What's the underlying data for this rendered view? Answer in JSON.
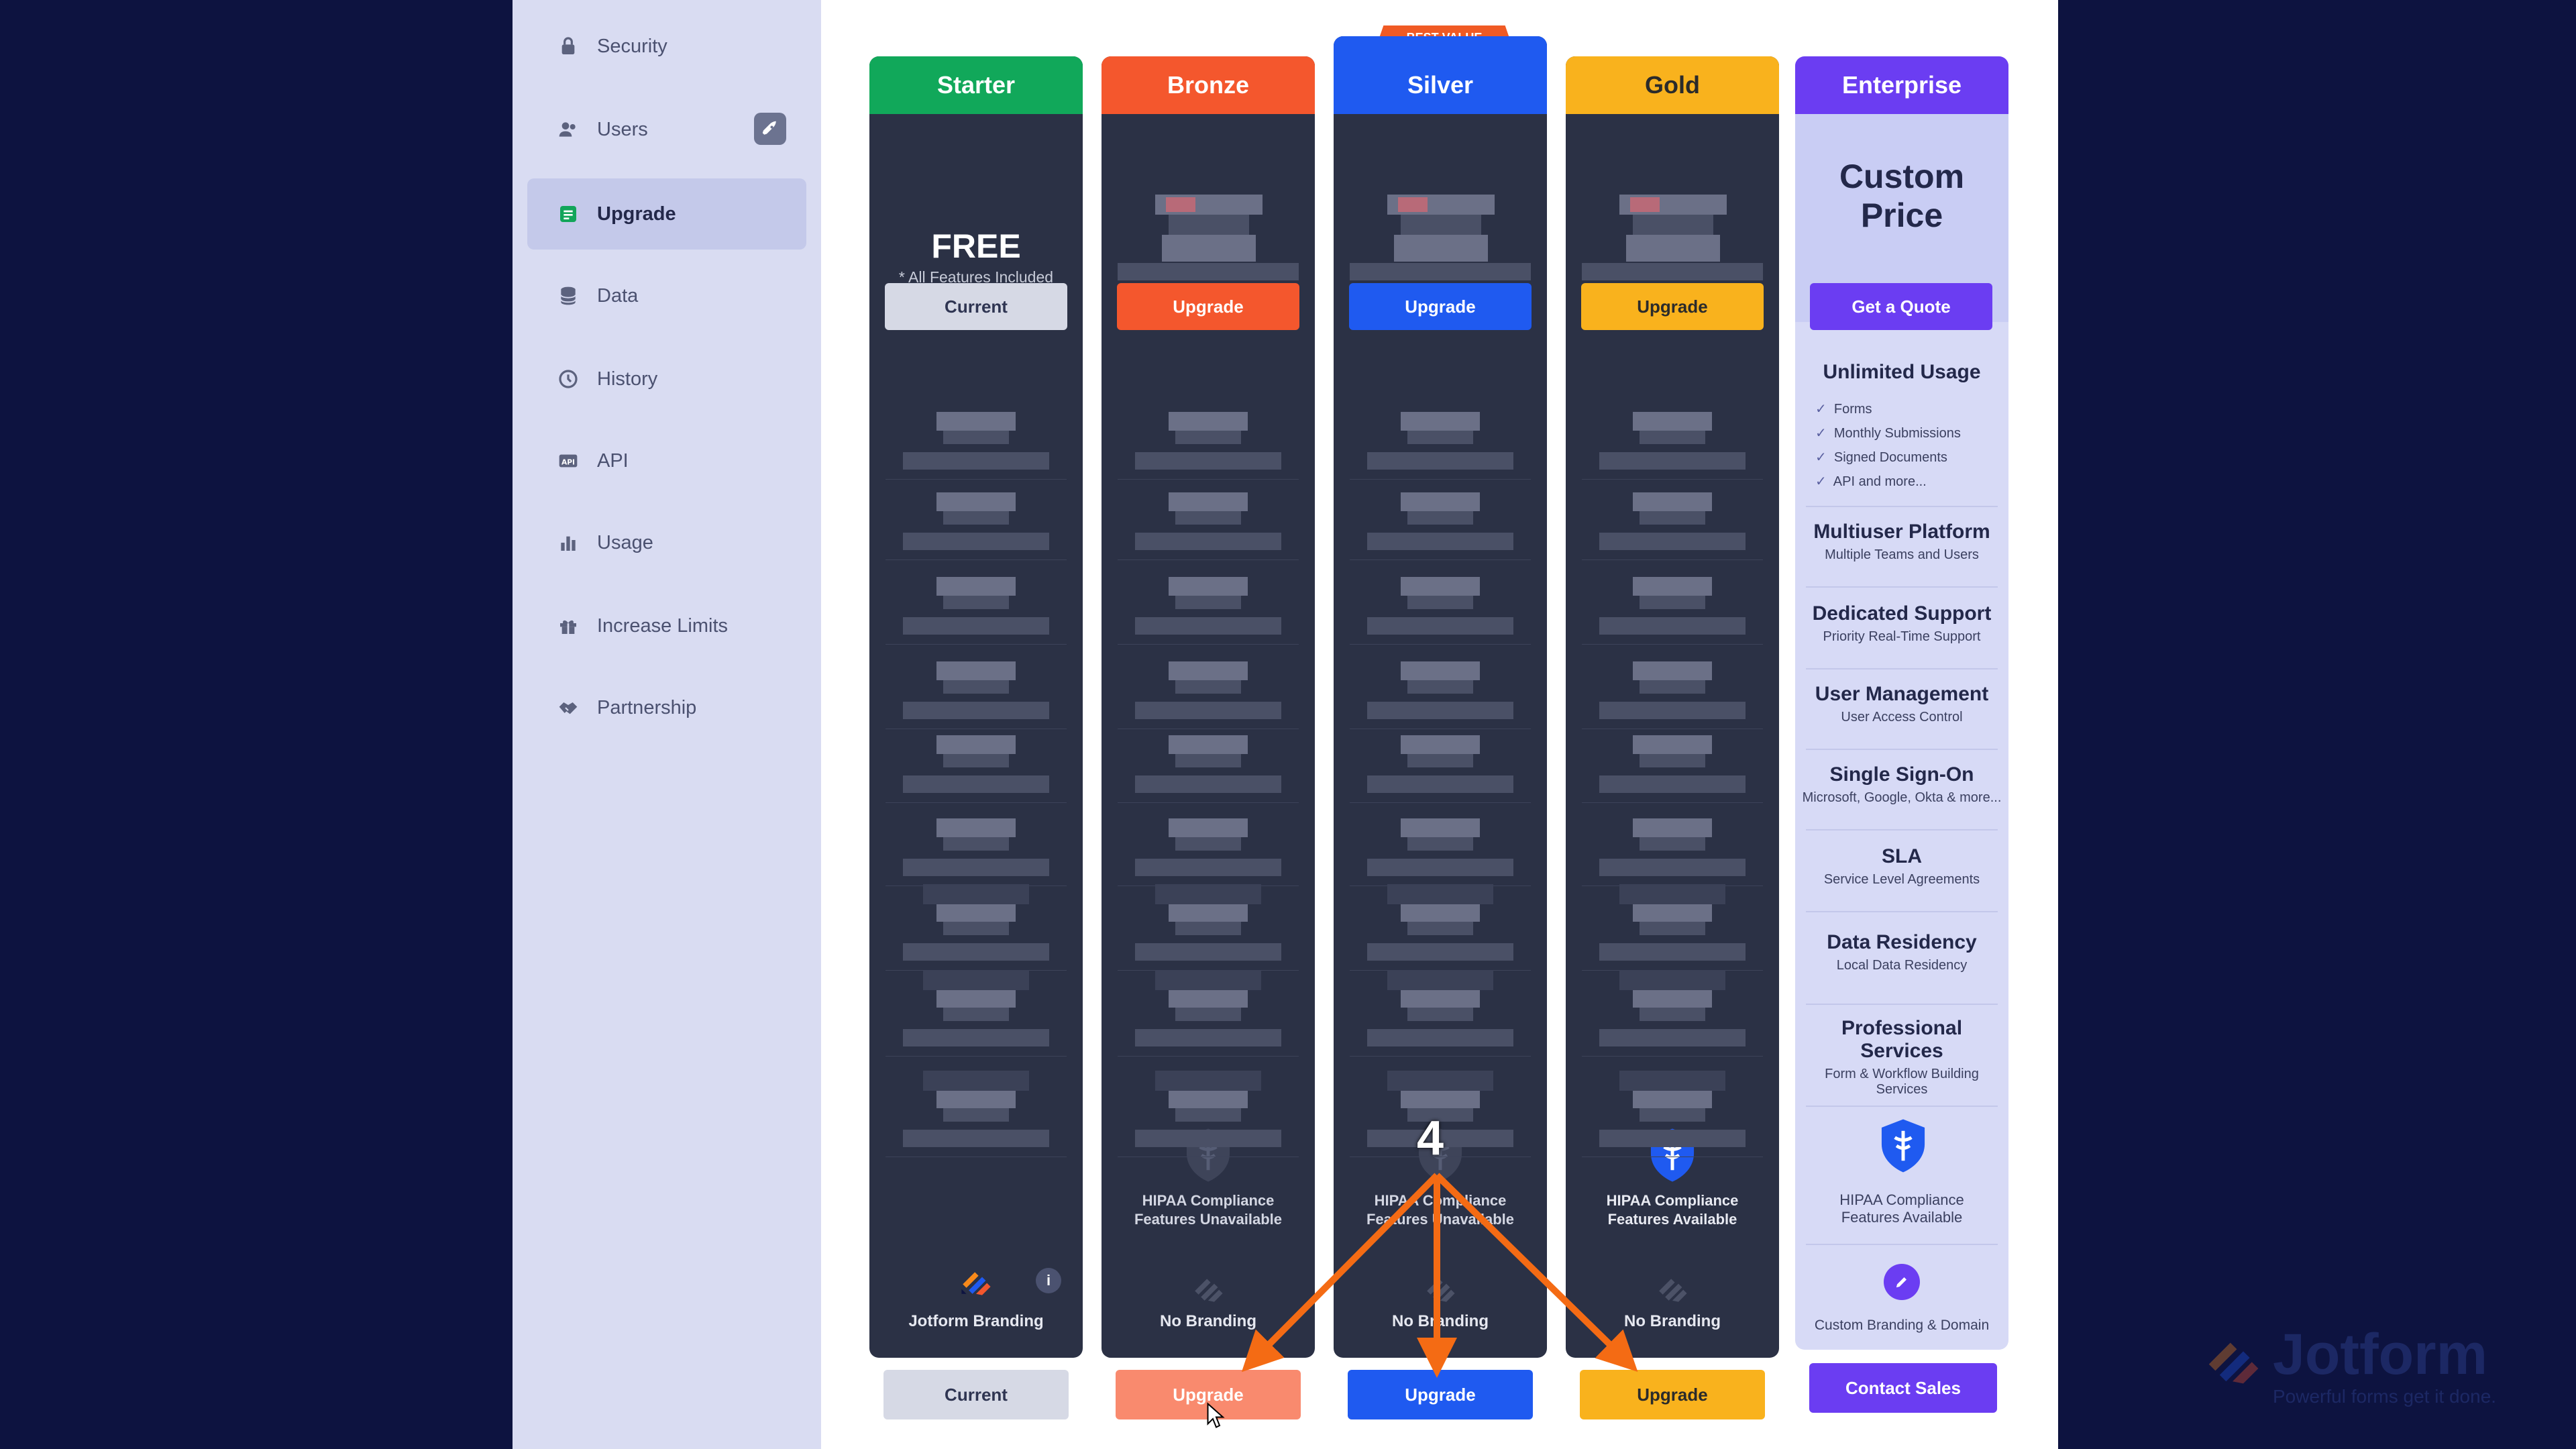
{
  "sidebar": {
    "items": [
      {
        "label": "Security",
        "icon": "lock-icon"
      },
      {
        "label": "Users",
        "icon": "users-icon"
      },
      {
        "label": "Upgrade",
        "icon": "upgrade-icon",
        "active": true
      },
      {
        "label": "Data",
        "icon": "database-icon"
      },
      {
        "label": "History",
        "icon": "history-icon"
      },
      {
        "label": "API",
        "icon": "api-icon"
      },
      {
        "label": "Usage",
        "icon": "bar-chart-icon"
      },
      {
        "label": "Increase Limits",
        "icon": "gift-icon"
      },
      {
        "label": "Partnership",
        "icon": "handshake-icon"
      }
    ]
  },
  "plans": {
    "best_value_badge": "BEST VALUE",
    "starter": {
      "name": "Starter",
      "color": "#11a85a",
      "price": "FREE",
      "price_note": "* All Features Included",
      "button": "Current",
      "branding": "Jotform Branding",
      "bottom_button": "Current"
    },
    "bronze": {
      "name": "Bronze",
      "color": "#f4572d",
      "button": "Upgrade",
      "hipaa": "HIPAA Compliance Features Unavailable",
      "branding": "No Branding",
      "bottom_button": "Upgrade",
      "bottom_color": "#f98a6e"
    },
    "silver": {
      "name": "Silver",
      "color": "#1f5af0",
      "button": "Upgrade",
      "hipaa": "HIPAA Compliance Features Unavailable",
      "branding": "No Branding",
      "bottom_button": "Upgrade"
    },
    "gold": {
      "name": "Gold",
      "color": "#f9b21d",
      "button": "Upgrade",
      "hipaa": "HIPAA Compliance Features Available",
      "branding": "No Branding",
      "bottom_button": "Upgrade"
    },
    "enterprise": {
      "name": "Enterprise",
      "color": "#6b3df2",
      "price_line1": "Custom",
      "price_line2": "Price",
      "button": "Get a Quote",
      "usage_title": "Unlimited Usage",
      "usage_items": [
        "Forms",
        "Monthly Submissions",
        "Signed Documents",
        "API and more..."
      ],
      "features": [
        {
          "title": "Multiuser Platform",
          "sub": "Multiple Teams and Users"
        },
        {
          "title": "Dedicated Support",
          "sub": "Priority Real-Time Support"
        },
        {
          "title": "User Management",
          "sub": "User Access Control"
        },
        {
          "title": "Single Sign-On",
          "sub": "Microsoft, Google, Okta & more..."
        },
        {
          "title": "SLA",
          "sub": "Service Level Agreements"
        },
        {
          "title": "Data Residency",
          "sub": "Local Data Residency"
        },
        {
          "title": "Professional Services",
          "sub": "Form & Workflow Building Services"
        }
      ],
      "hipaa": "HIPAA Compliance Features Available",
      "branding": "Custom Branding & Domain",
      "bottom_button": "Contact Sales"
    }
  },
  "annotation": {
    "step": "4",
    "color": "#f46b14"
  },
  "watermark": {
    "name": "Jotform",
    "tagline": "Powerful forms get it done."
  }
}
